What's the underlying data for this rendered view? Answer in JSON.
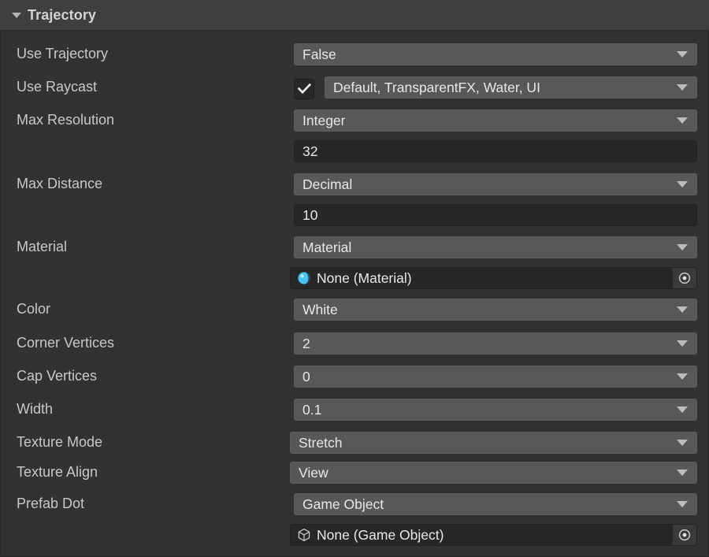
{
  "header": {
    "title": "Trajectory",
    "foldout_icon": "triangle-down-icon",
    "expanded": true
  },
  "colors": {
    "panel_bg": "#323232",
    "header_bg": "#3f3f3f",
    "popup_bg": "#585858",
    "input_bg": "#272727",
    "label_text": "#c8c8c8",
    "value_text": "#e8e8e8",
    "material_icon": "#4cc2f0"
  },
  "rows": [
    {
      "label": "Use Trajectory",
      "field_type": "popup",
      "value": "False",
      "caret_icon": "chevron-down-icon"
    },
    {
      "label": "Use Raycast",
      "field_type": "checkbox_popup",
      "checked": true,
      "check_icon": "check-icon",
      "value": "Default, TransparentFX, Water, UI",
      "caret_icon": "chevron-down-icon"
    },
    {
      "label": "Max Resolution",
      "field_type": "popup",
      "value": "Integer",
      "caret_icon": "chevron-down-icon"
    },
    {
      "label": "",
      "field_type": "text",
      "value": "32",
      "placeholder": ""
    },
    {
      "label": "Max Distance",
      "field_type": "popup",
      "value": "Decimal",
      "caret_icon": "chevron-down-icon"
    },
    {
      "label": "",
      "field_type": "text",
      "value": "10",
      "placeholder": ""
    },
    {
      "label": "Material",
      "field_type": "popup",
      "value": "Material",
      "caret_icon": "chevron-down-icon"
    },
    {
      "label": "",
      "field_type": "object",
      "value": "None (Material)",
      "object_icon": "material-sphere-icon",
      "picker_icon": "object-picker-icon"
    },
    {
      "label": "Color",
      "field_type": "popup",
      "value": "White",
      "caret_icon": "chevron-down-icon"
    },
    {
      "label": "Corner Vertices",
      "field_type": "popup",
      "value": "2",
      "caret_icon": "chevron-down-icon"
    },
    {
      "label": "Cap Vertices",
      "field_type": "popup",
      "value": "0",
      "caret_icon": "chevron-down-icon"
    },
    {
      "label": "Width",
      "field_type": "popup",
      "value": "0.1",
      "caret_icon": "chevron-down-icon"
    },
    {
      "label": "Texture Mode",
      "field_type": "popup",
      "value": "Stretch",
      "caret_icon": "chevron-down-icon"
    },
    {
      "label": "Texture Align",
      "field_type": "popup",
      "value": "View",
      "caret_icon": "chevron-down-icon"
    },
    {
      "label": "Prefab Dot",
      "field_type": "popup",
      "value": "Game Object",
      "caret_icon": "chevron-down-icon"
    },
    {
      "label": "",
      "field_type": "object",
      "value": "None (Game Object)",
      "object_icon": "cube-wireframe-icon",
      "picker_icon": "object-picker-icon"
    }
  ]
}
